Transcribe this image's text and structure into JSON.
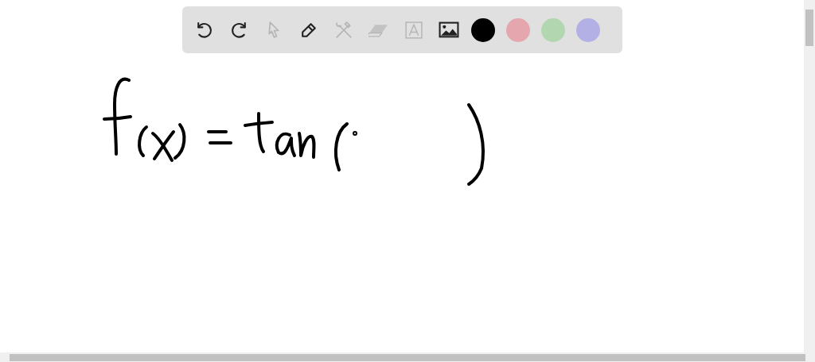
{
  "toolbar": {
    "tools": [
      {
        "kind": "undo",
        "disabled": false
      },
      {
        "kind": "redo",
        "disabled": false
      },
      {
        "kind": "pointer",
        "disabled": true
      },
      {
        "kind": "pen",
        "disabled": false
      },
      {
        "kind": "tools",
        "disabled": true
      },
      {
        "kind": "eraser",
        "disabled": true
      },
      {
        "kind": "text",
        "disabled": true
      },
      {
        "kind": "image",
        "disabled": false
      }
    ],
    "colors": [
      {
        "color": "#000000"
      },
      {
        "color": "#e6a6ad"
      },
      {
        "color": "#b2d6b0"
      },
      {
        "color": "#b3b0e6"
      }
    ]
  }
}
